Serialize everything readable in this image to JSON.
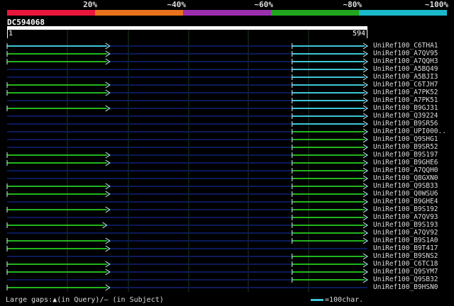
{
  "legend": {
    "segments": [
      {
        "label": "20%",
        "color": "#e8173b"
      },
      {
        "label": "~40%",
        "color": "#e8731c"
      },
      {
        "label": "~60%",
        "color": "#9b2fae"
      },
      {
        "label": "~80%",
        "color": "#22a51e"
      },
      {
        "label": "~100%",
        "color": "#1ab9c9"
      }
    ]
  },
  "query": {
    "id": "DC594068",
    "start": "1",
    "end": "594",
    "length": 594
  },
  "colors": {
    "green": "#22b51e",
    "cyan": "#3ec6d6",
    "dark_line": "#0a1a5a",
    "grid": "#1f3a1f"
  },
  "hits": [
    {
      "name": "UniRef100_C6THA1",
      "segments": [
        [
          1,
          170,
          "cyan"
        ],
        [
          470,
          594,
          "cyan"
        ]
      ]
    },
    {
      "name": "UniRef100_A7QV95",
      "segments": [
        [
          1,
          170,
          "green"
        ],
        [
          470,
          594,
          "cyan"
        ]
      ]
    },
    {
      "name": "UniRef100_A7QQH3",
      "segments": [
        [
          1,
          170,
          "green"
        ],
        [
          470,
          594,
          "cyan"
        ]
      ]
    },
    {
      "name": "UniRef100_A5BQ49",
      "segments": [
        [
          470,
          594,
          "cyan"
        ]
      ]
    },
    {
      "name": "UniRef100_A5BJI3",
      "segments": [
        [
          470,
          594,
          "cyan"
        ]
      ]
    },
    {
      "name": "UniRef100_C6TJH7",
      "segments": [
        [
          1,
          170,
          "green"
        ],
        [
          470,
          594,
          "cyan"
        ]
      ]
    },
    {
      "name": "UniRef100_A7PK52",
      "segments": [
        [
          1,
          170,
          "green"
        ],
        [
          470,
          594,
          "cyan"
        ]
      ]
    },
    {
      "name": "UniRef100_A7PK51",
      "segments": [
        [
          470,
          594,
          "cyan"
        ]
      ]
    },
    {
      "name": "UniRef100_B9GJ31",
      "segments": [
        [
          1,
          170,
          "green"
        ],
        [
          470,
          594,
          "cyan"
        ]
      ]
    },
    {
      "name": "UniRef100_Q39224",
      "segments": [
        [
          470,
          594,
          "cyan"
        ]
      ]
    },
    {
      "name": "UniRef100_B9SR56",
      "segments": [
        [
          470,
          594,
          "cyan"
        ]
      ]
    },
    {
      "name": "UniRef100_UPI000..",
      "segments": [
        [
          470,
          594,
          "green"
        ]
      ]
    },
    {
      "name": "UniRef100_Q9SHG1",
      "segments": [
        [
          470,
          594,
          "green"
        ]
      ]
    },
    {
      "name": "UniRef100_B9SR52",
      "segments": [
        [
          470,
          594,
          "green"
        ]
      ]
    },
    {
      "name": "UniRef100_B9S197",
      "segments": [
        [
          1,
          170,
          "green"
        ],
        [
          470,
          594,
          "green"
        ]
      ]
    },
    {
      "name": "UniRef100_B9GHE6",
      "segments": [
        [
          1,
          170,
          "green"
        ],
        [
          470,
          594,
          "green"
        ]
      ]
    },
    {
      "name": "UniRef100_A7QQH0",
      "segments": [
        [
          470,
          594,
          "green"
        ]
      ]
    },
    {
      "name": "UniRef100_Q8GXN0",
      "segments": [
        [
          470,
          594,
          "green"
        ]
      ]
    },
    {
      "name": "UniRef100_Q9SB33",
      "segments": [
        [
          1,
          170,
          "green"
        ],
        [
          470,
          594,
          "green"
        ]
      ]
    },
    {
      "name": "UniRef100_Q0WSU6",
      "segments": [
        [
          1,
          170,
          "green"
        ],
        [
          470,
          594,
          "green"
        ]
      ]
    },
    {
      "name": "UniRef100_B9GHE4",
      "segments": [
        [
          470,
          594,
          "green"
        ]
      ]
    },
    {
      "name": "UniRef100_B9S192",
      "segments": [
        [
          1,
          170,
          "green"
        ],
        [
          470,
          594,
          "green"
        ]
      ]
    },
    {
      "name": "UniRef100_A7QV93",
      "segments": [
        [
          470,
          594,
          "green"
        ]
      ]
    },
    {
      "name": "UniRef100_B9S193",
      "segments": [
        [
          1,
          165,
          "green"
        ],
        [
          470,
          594,
          "green"
        ]
      ]
    },
    {
      "name": "UniRef100_A7QV92",
      "segments": [
        [
          470,
          594,
          "green"
        ]
      ]
    },
    {
      "name": "UniRef100_B9S1A0",
      "segments": [
        [
          1,
          170,
          "green"
        ],
        [
          470,
          594,
          "green"
        ]
      ]
    },
    {
      "name": "UniRef100_B9T417",
      "segments": [
        [
          1,
          170,
          "green"
        ]
      ]
    },
    {
      "name": "UniRef100_B9SNS2",
      "segments": [
        [
          470,
          594,
          "green"
        ]
      ]
    },
    {
      "name": "UniRef100_C6TC18",
      "segments": [
        [
          1,
          170,
          "green"
        ],
        [
          470,
          594,
          "green"
        ]
      ]
    },
    {
      "name": "UniRef100_Q9SYM7",
      "segments": [
        [
          1,
          170,
          "green"
        ],
        [
          470,
          594,
          "green"
        ]
      ]
    },
    {
      "name": "UniRef100_Q9SB32",
      "segments": [
        [
          470,
          594,
          "green"
        ]
      ]
    },
    {
      "name": "UniRef100_B9HSN0",
      "segments": [
        [
          1,
          170,
          "green"
        ]
      ]
    }
  ],
  "footer": {
    "gaps_text": "Large gaps:▲(in Query)/– (in Subject)",
    "scale_text": "=100char."
  }
}
